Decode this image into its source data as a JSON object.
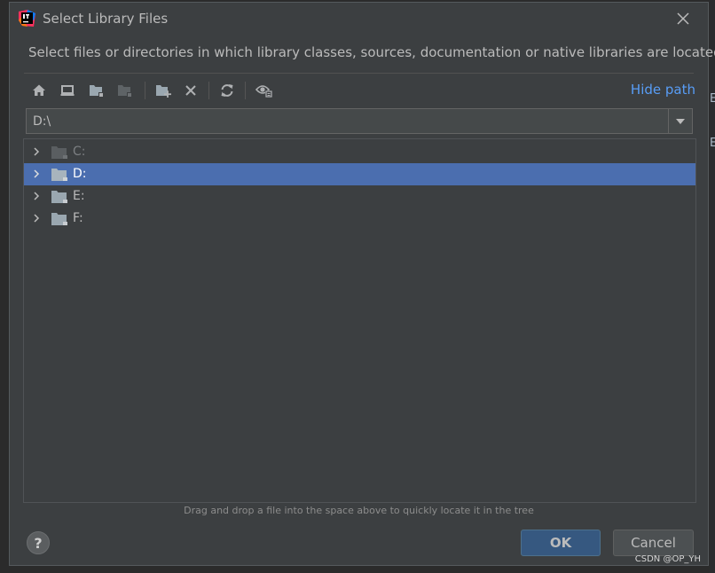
{
  "dialog": {
    "title": "Select Library Files",
    "description": "Select files or directories in which library classes, sources, documentation or native libraries are located",
    "hide_path_label": "Hide path",
    "path_value": "D:\\",
    "hint": "Drag and drop a file into the space above to quickly locate it in the tree",
    "help_label": "?",
    "ok_label": "OK",
    "cancel_label": "Cancel"
  },
  "toolbar": {
    "icons": [
      "home-icon",
      "desktop-icon",
      "project-folder-icon",
      "module-folder-icon",
      "new-folder-icon",
      "delete-icon",
      "refresh-icon",
      "show-hidden-icon"
    ]
  },
  "tree": {
    "items": [
      {
        "label": "C:",
        "selected": false,
        "dimmed": true
      },
      {
        "label": "D:",
        "selected": true,
        "dimmed": false
      },
      {
        "label": "E:",
        "selected": false,
        "dimmed": false
      },
      {
        "label": "F:",
        "selected": false,
        "dimmed": false
      }
    ]
  },
  "background": {
    "letter_1": "E",
    "letter_2": "E"
  },
  "watermark": "CSDN @OP_YH",
  "colors": {
    "dialog_bg": "#3c3f41",
    "selection": "#4b6eaf",
    "link": "#589df6",
    "ok_button": "#365880"
  }
}
